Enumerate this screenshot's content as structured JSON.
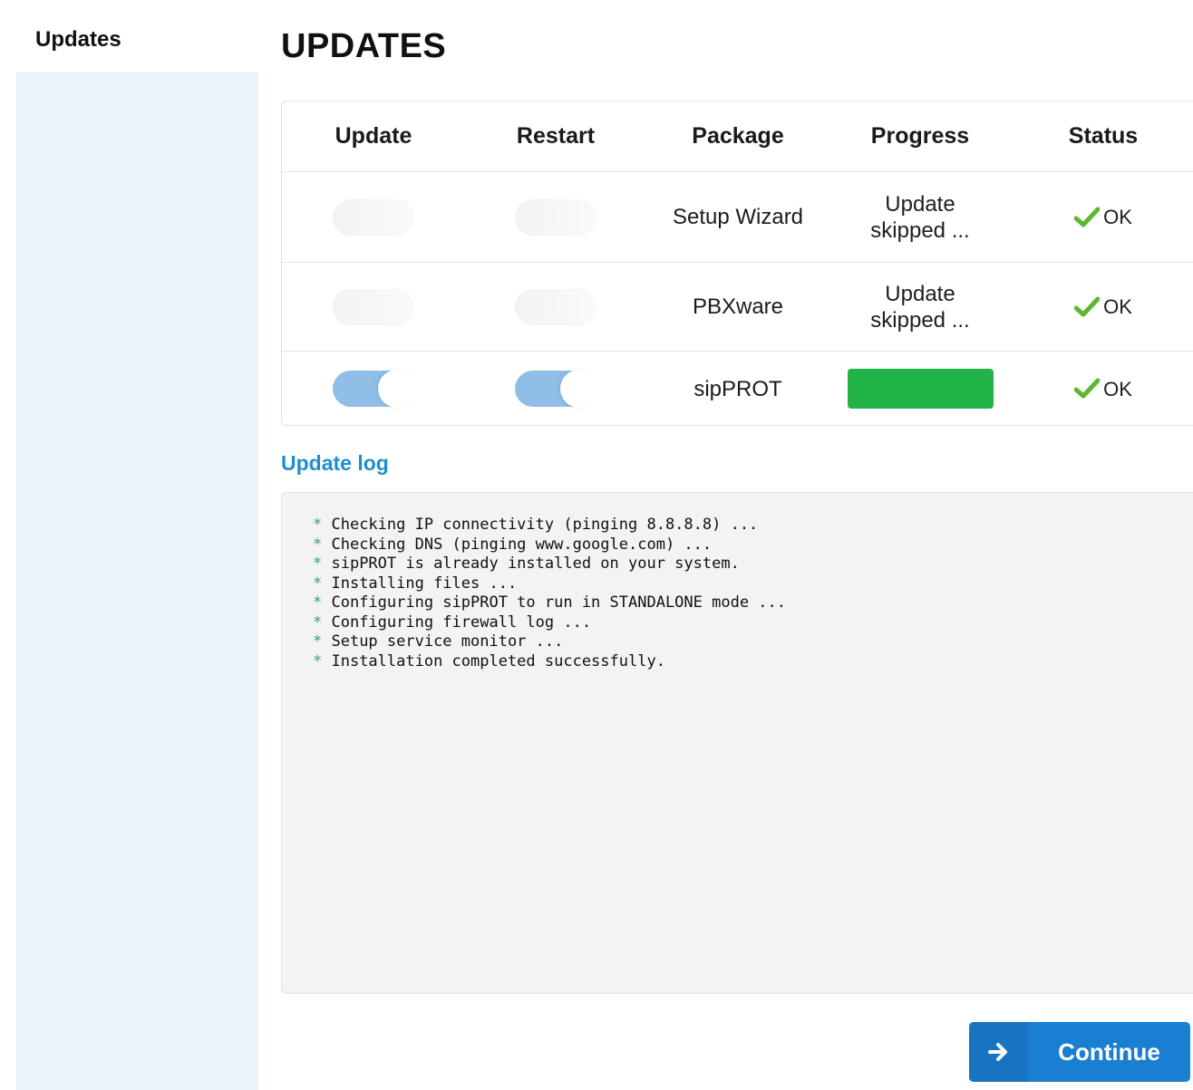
{
  "sidebar": {
    "title": "Updates"
  },
  "page": {
    "title": "UPDATES"
  },
  "table": {
    "headers": [
      "Update",
      "Restart",
      "Package",
      "Progress",
      "Status"
    ],
    "rows": [
      {
        "update_on": false,
        "restart_on": false,
        "package": "Setup Wizard",
        "progress_text": "Update skipped ...",
        "status": "OK"
      },
      {
        "update_on": false,
        "restart_on": false,
        "package": "PBXware",
        "progress_text": "Update skipped ...",
        "status": "OK"
      },
      {
        "update_on": true,
        "restart_on": true,
        "package": "sipPROT",
        "progress_pct": 100,
        "status": "OK"
      }
    ]
  },
  "log": {
    "heading": "Update log",
    "lines": [
      "Checking IP connectivity (pinging 8.8.8.8) ...",
      "Checking DNS (pinging www.google.com) ...",
      "sipPROT is already installed on your system.",
      "Installing files ...",
      "Configuring sipPROT to run in STANDALONE mode ...",
      "Configuring firewall log ...",
      "Setup service monitor ...",
      "Installation completed successfully."
    ],
    "bullet": "*"
  },
  "actions": {
    "continue_label": "Continue"
  },
  "icons": {
    "status": "check-icon",
    "continue": "arrow-right-icon"
  },
  "colors": {
    "accent": "#1b7fd1",
    "ok_green": "#5cb82e",
    "progress_green": "#22b447",
    "toggle_on": "#8fbfe6",
    "sidebar_bg": "#eaf2fa",
    "link_blue": "#1e8fcf"
  }
}
